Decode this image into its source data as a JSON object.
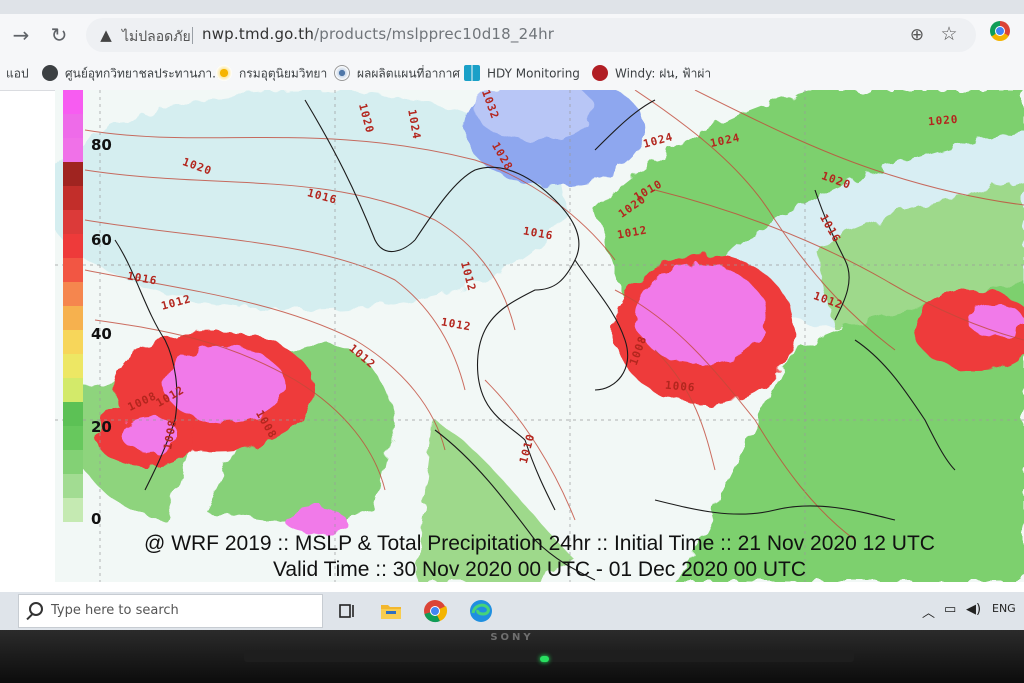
{
  "browser": {
    "security_label": "ไม่ปลอดภัย",
    "url_host": "nwp.tmd.go.th",
    "url_path": "/products/mslpprec10d18_24hr"
  },
  "bookmarks": [
    {
      "label": "แอป",
      "icon": "apps-icon"
    },
    {
      "label": "ศูนย์อุทกวิทยาชลประทานภา...",
      "icon": "globe-icon"
    },
    {
      "label": "กรมอุตุนิยมวิทยา",
      "icon": "sun-icon"
    },
    {
      "label": "ผลผลิตแผนที่อากาศ",
      "icon": "tmd-logo-icon"
    },
    {
      "label": "HDY Monitoring",
      "icon": "windows-icon"
    },
    {
      "label": "Windy: ฝน, ฟ้าผ่า",
      "icon": "windy-icon"
    }
  ],
  "map": {
    "legend_ticks": [
      "80",
      "60",
      "40",
      "20",
      "0"
    ],
    "legend_colors": [
      "#f75cf1",
      "#ee6be9",
      "#f071e8",
      "#f17ae9",
      "#a02420",
      "#c22e2a",
      "#dc3a39",
      "#ee3a3a",
      "#f25643",
      "#f5864e",
      "#f6b14e",
      "#f7d65a",
      "#ede764",
      "#d3ea6a",
      "#5cc155",
      "#67c85d",
      "#83d175",
      "#a2dc92",
      "#c5eab2"
    ],
    "isobar_labels": [
      "1020",
      "1016",
      "1016",
      "1012",
      "1008",
      "1008",
      "1012",
      "1012",
      "1024",
      "1020",
      "1028",
      "1032",
      "1016",
      "1012",
      "1010",
      "1012",
      "1024",
      "1020",
      "1024",
      "1020",
      "1020",
      "1016",
      "1012",
      "1008",
      "1006",
      "1008",
      "1012",
      "1010"
    ],
    "caption_line1": "@ WRF 2019 :: MSLP & Total Precipitation 24hr :: Initial Time :: 21 Nov 2020 12 UTC",
    "caption_line2": "Valid Time :: 30 Nov 2020 00 UTC - 01 Dec 2020 00 UTC"
  },
  "taskbar": {
    "search_placeholder": "Type here to search",
    "language": "ENG"
  },
  "monitor": {
    "brand": "SONY"
  }
}
